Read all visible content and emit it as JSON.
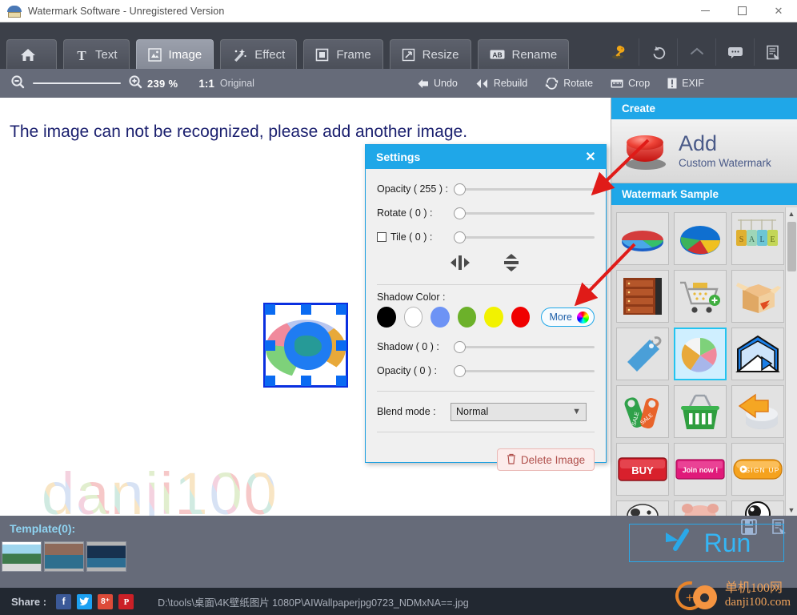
{
  "window": {
    "title": "Watermark Software - Unregistered Version",
    "app_icon": "watermark-app-icon",
    "minimize": "—",
    "maximize": "□",
    "close": "✕"
  },
  "tabs": [
    {
      "id": "home",
      "label": "",
      "icon": "home-icon",
      "active": false
    },
    {
      "id": "text",
      "label": "Text",
      "icon": "text-icon",
      "active": false
    },
    {
      "id": "image",
      "label": "Image",
      "icon": "image-icon",
      "active": true
    },
    {
      "id": "effect",
      "label": "Effect",
      "icon": "effect-icon",
      "active": false
    },
    {
      "id": "frame",
      "label": "Frame",
      "icon": "frame-icon",
      "active": false
    },
    {
      "id": "resize",
      "label": "Resize",
      "icon": "resize-icon",
      "active": false
    },
    {
      "id": "rename",
      "label": "Rename",
      "icon": "rename-icon",
      "active": false
    }
  ],
  "toolbar_right": [
    {
      "id": "key",
      "icon": "key-icon"
    },
    {
      "id": "undo",
      "icon": "undo-arrow-icon"
    },
    {
      "id": "redo",
      "icon": "redo-arrow-icon"
    },
    {
      "id": "feedback",
      "icon": "speech-bubble-icon"
    },
    {
      "id": "register",
      "icon": "register-document-icon"
    }
  ],
  "zoombar": {
    "zoom_out_icon": "zoom-out-icon",
    "zoom_in_icon": "zoom-in-icon",
    "zoom_percent": "239 %",
    "one_to_one": "1:1",
    "original_label": "Original",
    "actions": [
      {
        "id": "undo",
        "label": "Undo",
        "icon": "undo-triangle-icon"
      },
      {
        "id": "rebuild",
        "label": "Rebuild",
        "icon": "rebuild-double-triangle-icon"
      },
      {
        "id": "rotate",
        "label": "Rotate",
        "icon": "rotate-icon"
      },
      {
        "id": "crop",
        "label": "Crop",
        "icon": "crop-icon"
      },
      {
        "id": "exif",
        "label": "EXIF",
        "icon": "exif-icon"
      }
    ]
  },
  "canvas": {
    "message": "The image can not be recognized, please add another image.",
    "watermark_text": "danji100",
    "watermark_image": "pie-chart-globe-watermark"
  },
  "dialog": {
    "title": "Settings",
    "close_icon": "close-icon",
    "opacity_label": "Opacity ( 255 ) :",
    "rotate_label": "Rotate ( 0 ) :",
    "tile_label": "Tile ( 0 ) :",
    "tile_checked": false,
    "flip_horizontal_icon": "flip-horizontal-icon",
    "flip_vertical_icon": "flip-vertical-icon",
    "shadow_color_label": "Shadow Color :",
    "shadow_colors": [
      "#000000",
      "#ffffff",
      "#6d93f5",
      "#6cb12a",
      "#f2f200",
      "#f00000"
    ],
    "more_label": "More",
    "more_icon": "rainbow-color-picker-icon",
    "shadow_label": "Shadow ( 0 ) :",
    "shadow_opacity_label": "Opacity ( 0 ) :",
    "blend_mode_label": "Blend mode :",
    "blend_mode_value": "Normal",
    "blend_mode_options": [
      "Normal"
    ],
    "delete_label": "Delete Image",
    "delete_icon": "trash-icon"
  },
  "right_panel": {
    "create_header": "Create",
    "add_title": "Add",
    "add_subtitle": "Custom Watermark",
    "add_button_icon": "red-push-button-icon",
    "sample_header": "Watermark Sample",
    "samples": [
      {
        "id": "pie-3d-flat",
        "icon": "pie-chart-3d-red-blue-icon",
        "selected": false
      },
      {
        "id": "pie-3d-blue",
        "icon": "pie-chart-3d-blue-icon",
        "selected": false
      },
      {
        "id": "sale-tags",
        "icon": "sale-hanging-tags-icon",
        "selected": false
      },
      {
        "id": "server-rack",
        "icon": "server-rack-icon",
        "selected": false
      },
      {
        "id": "shopping-cart",
        "icon": "shopping-cart-add-icon",
        "selected": false
      },
      {
        "id": "open-box",
        "icon": "open-cardboard-box-icon",
        "selected": false
      },
      {
        "id": "blue-tag",
        "icon": "blue-price-tag-icon",
        "selected": false
      },
      {
        "id": "pie-chart-color",
        "icon": "pie-chart-color-icon",
        "selected": true
      },
      {
        "id": "envelope",
        "icon": "open-envelope-cursor-icon",
        "selected": false
      },
      {
        "id": "sale-door-tags",
        "icon": "sale-door-hanger-tags-icon",
        "selected": false
      },
      {
        "id": "basket",
        "icon": "green-shopping-basket-icon",
        "selected": false
      },
      {
        "id": "coins-arrow",
        "icon": "coins-stack-arrow-icon",
        "selected": false
      },
      {
        "id": "buy-button",
        "icon": "buy-button-icon",
        "label": "BUY",
        "selected": false
      },
      {
        "id": "join-button",
        "icon": "join-now-button-icon",
        "label": "Join now !",
        "selected": false
      },
      {
        "id": "signup-button",
        "icon": "sign-up-button-icon",
        "label": "SIGN UP",
        "selected": false
      },
      {
        "id": "cow-face",
        "icon": "cow-face-icon",
        "selected": false
      },
      {
        "id": "pig-face",
        "icon": "pig-face-icon",
        "selected": false
      },
      {
        "id": "eye-ball",
        "icon": "eye-ball-icon",
        "selected": false
      }
    ],
    "scroll_up_icon": "chevron-up-icon",
    "scroll_down_icon": "chevron-down-icon"
  },
  "template_bar": {
    "title": "Template(0):",
    "save_icon": "save-floppy-icon",
    "load_icon": "load-template-icon",
    "thumbnails": [
      "template-thumb-street",
      "template-thumb-lake",
      "template-thumb-night-sea"
    ],
    "run_label": "Run",
    "run_icon": "run-arrow-icon"
  },
  "status_bar": {
    "share_label": "Share :",
    "socials": [
      {
        "id": "facebook",
        "glyph": "f",
        "color": "#3b5998"
      },
      {
        "id": "twitter",
        "glyph": "ᵛ",
        "color": "#1da1f2"
      },
      {
        "id": "googleplus",
        "glyph": "8⁺",
        "color": "#dd4b39"
      },
      {
        "id": "pinterest",
        "glyph": "𝓟",
        "color": "#cb2027"
      }
    ],
    "file_path": "D:\\tools\\桌面\\4K壁纸图片 1080P\\AIWallpaperjpg0723_NDMxNA==.jpg"
  },
  "overlay_logo": {
    "line1": "单机100网",
    "line2": "danji100.com"
  },
  "colors": {
    "accent_blue": "#1fa7e8",
    "tabstrip": "#3c4049",
    "zoombar": "#666b79",
    "status": "#222831",
    "arrow_red": "#e01b18"
  }
}
